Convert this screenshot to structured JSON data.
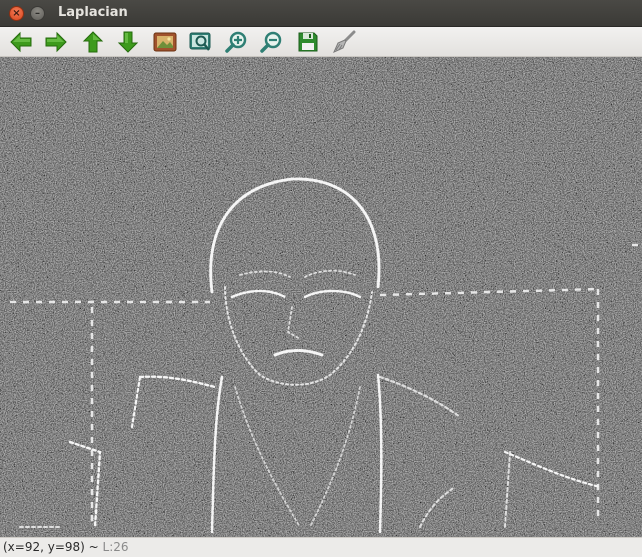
{
  "window": {
    "title": "Laplacian",
    "close_glyph": "×",
    "minimize_glyph": "–"
  },
  "toolbar": {
    "buttons": [
      {
        "name": "pan-left-button",
        "icon": "arrow-left-icon",
        "tooltip": "Left"
      },
      {
        "name": "pan-right-button",
        "icon": "arrow-right-icon",
        "tooltip": "Right"
      },
      {
        "name": "pan-up-button",
        "icon": "arrow-up-icon",
        "tooltip": "Up"
      },
      {
        "name": "pan-down-button",
        "icon": "arrow-down-icon",
        "tooltip": "Down"
      },
      {
        "name": "zoom-original-button",
        "icon": "picture-icon",
        "tooltip": "Zoom x1"
      },
      {
        "name": "zoom-fit-button",
        "icon": "zoom-fit-icon",
        "tooltip": "Zoom fit"
      },
      {
        "name": "zoom-in-button",
        "icon": "zoom-in-icon",
        "tooltip": "Zoom in"
      },
      {
        "name": "zoom-out-button",
        "icon": "zoom-out-icon",
        "tooltip": "Zoom out"
      },
      {
        "name": "save-button",
        "icon": "floppy-disk-icon",
        "tooltip": "Save"
      },
      {
        "name": "properties-button",
        "icon": "brush-icon",
        "tooltip": "Properties"
      }
    ],
    "icon_colors": {
      "arrow_green": "#3d9a1c",
      "picture_brown": "#a0522d",
      "floppy_green": "#2e8b2e",
      "magnifier_teal": "#2f7f74",
      "brush_gray": "#9a9a9a"
    }
  },
  "image": {
    "description_tag": "laplacian-edge-image",
    "background": "#050505",
    "edge_color": "#f2f2f2"
  },
  "status": {
    "coords": "(x=92, y=98) ~",
    "level": "L:26"
  }
}
